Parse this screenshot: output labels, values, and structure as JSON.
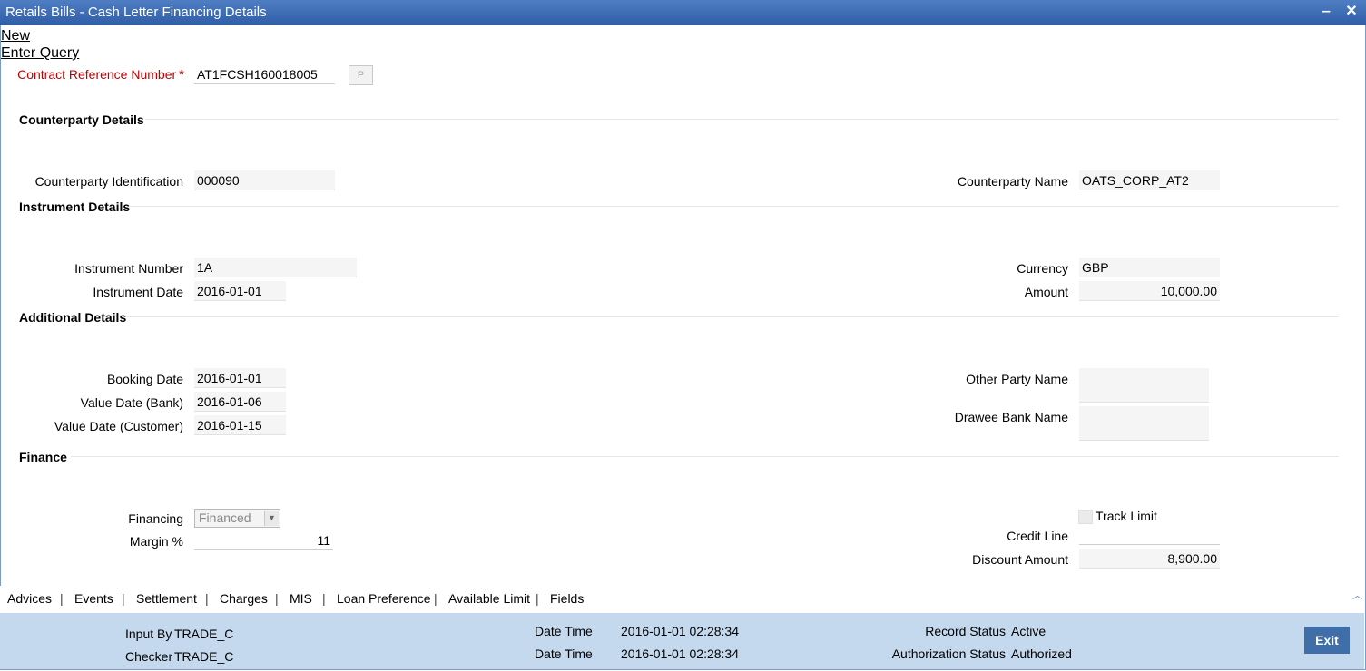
{
  "window": {
    "title": "Retails Bills - Cash Letter Financing Details",
    "minimize": "‒",
    "close": "✕"
  },
  "menu": {
    "new": "New",
    "enter_query": "Enter Query"
  },
  "contract": {
    "label": "Contract Reference Number",
    "required": "*",
    "value": "AT1FCSH160018005",
    "p_button": "P"
  },
  "sections": {
    "counterparty": "Counterparty Details",
    "instrument": "Instrument Details",
    "additional": "Additional Details",
    "finance": "Finance"
  },
  "counterparty": {
    "id_label": "Counterparty Identification",
    "id_value": "000090",
    "name_label": "Counterparty Name",
    "name_value": "OATS_CORP_AT2"
  },
  "instrument": {
    "number_label": "Instrument Number",
    "number_value": "1A",
    "date_label": "Instrument Date",
    "date_value": "2016-01-01",
    "currency_label": "Currency",
    "currency_value": "GBP",
    "amount_label": "Amount",
    "amount_value": "10,000.00"
  },
  "additional": {
    "booking_label": "Booking Date",
    "booking_value": "2016-01-01",
    "value_bank_label": "Value Date (Bank)",
    "value_bank_value": "2016-01-06",
    "value_cust_label": "Value Date (Customer)",
    "value_cust_value": "2016-01-15",
    "other_party_label": "Other Party Name",
    "other_party_value": "",
    "drawee_label": "Drawee Bank Name",
    "drawee_value": ""
  },
  "finance": {
    "financing_label": "Financing",
    "financing_value": "Financed",
    "margin_label": "Margin %",
    "margin_value": "11",
    "track_limit_label": "Track Limit",
    "credit_line_label": "Credit Line",
    "credit_line_value": "",
    "discount_label": "Discount Amount",
    "discount_value": "8,900.00"
  },
  "tabs": [
    "Advices",
    "Events",
    "Settlement",
    "Charges",
    "MIS",
    "Loan Preference",
    "Available Limit",
    "Fields"
  ],
  "footer": {
    "input_by_label": "Input By",
    "input_by_value": "TRADE_C",
    "checker_label": "Checker",
    "checker_value": "TRADE_C",
    "datetime_label_1": "Date Time",
    "datetime_value_1": "2016-01-01 02:28:34",
    "datetime_label_2": "Date Time",
    "datetime_value_2": "2016-01-01 02:28:34",
    "record_status_label": "Record Status",
    "record_status_value": "Active",
    "auth_status_label": "Authorization Status",
    "auth_status_value": "Authorized",
    "exit_label": "Exit"
  }
}
